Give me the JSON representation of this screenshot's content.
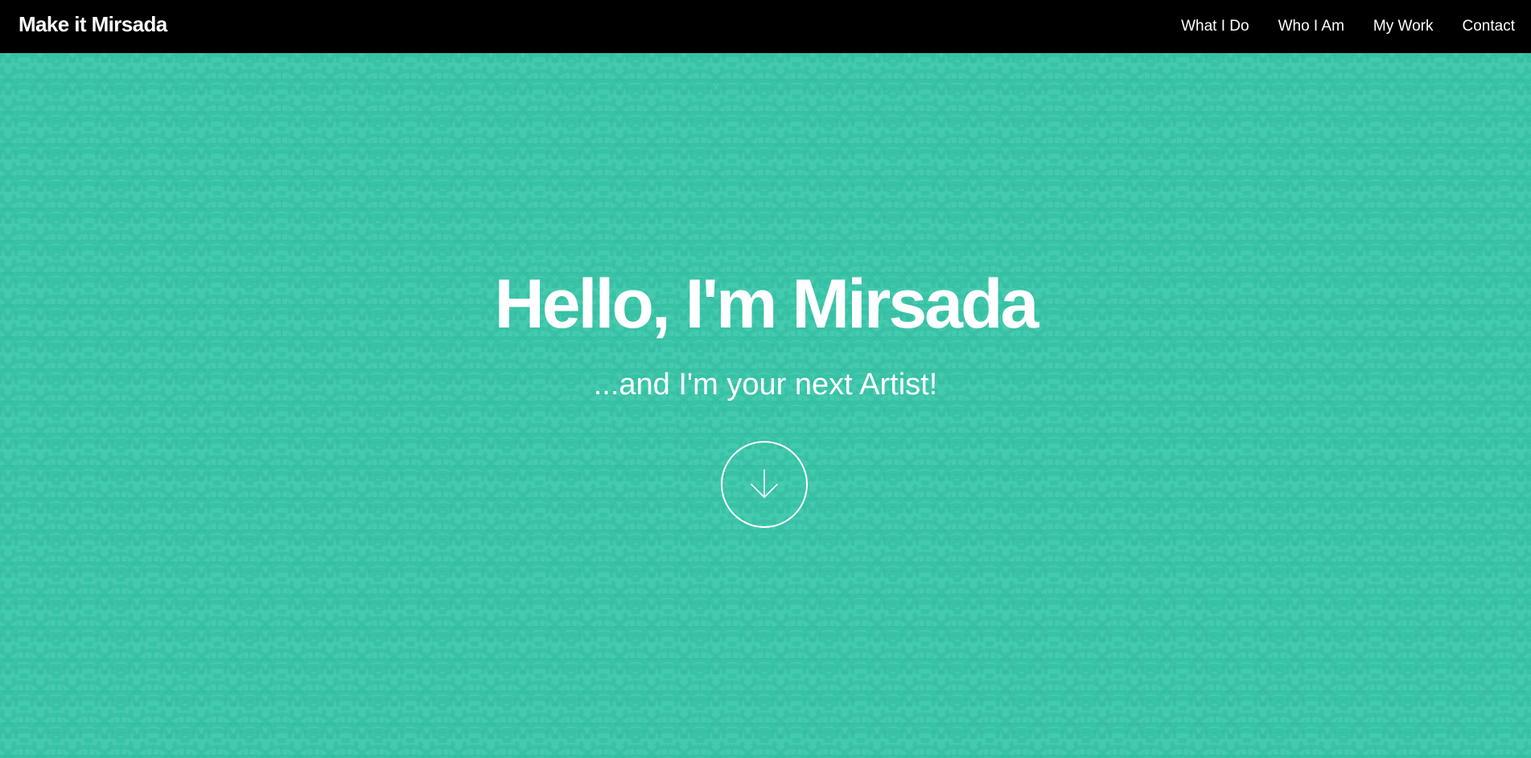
{
  "colors": {
    "nav_background": "#000000",
    "hero_background": "#36c3a6",
    "pattern_wave": "#4fd0b5",
    "text": "#ffffff"
  },
  "navbar": {
    "brand": "Make it Mirsada",
    "links": [
      {
        "label": "What I Do"
      },
      {
        "label": "Who I Am"
      },
      {
        "label": "My Work"
      },
      {
        "label": "Contact"
      }
    ]
  },
  "hero": {
    "title": "Hello, I'm Mirsada",
    "subtitle": "...and I'm your next Artist!",
    "scroll_button_icon": "arrow-down-icon"
  }
}
